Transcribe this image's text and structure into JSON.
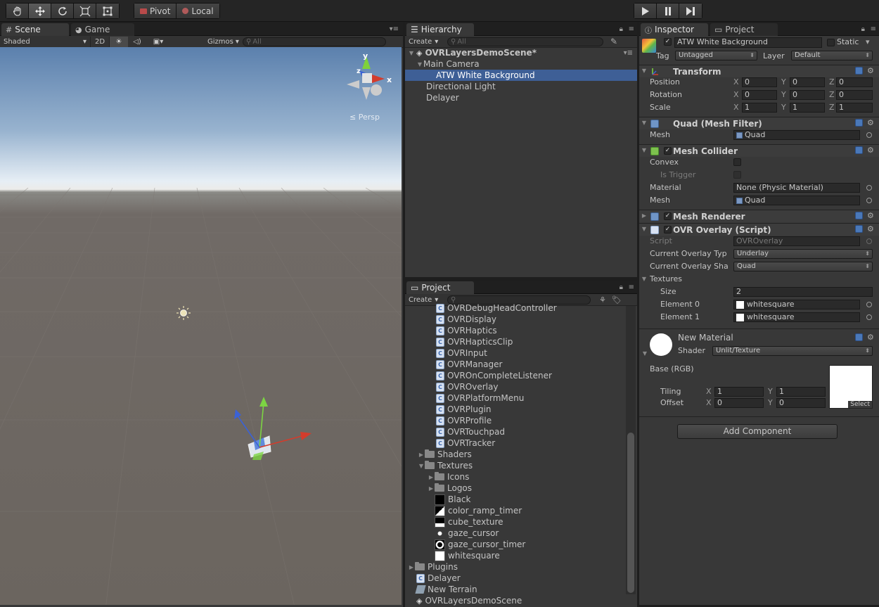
{
  "toolbar": {
    "pivot_label": "Pivot",
    "local_label": "Local"
  },
  "scene": {
    "tab_label": "Scene",
    "game_tab_label": "Game",
    "shading_mode": "Shaded",
    "mode_2d": "2D",
    "gizmos_label": "Gizmos",
    "search_placeholder": "All",
    "persp_label": "Persp",
    "axis_y": "y",
    "axis_x": "x",
    "axis_z": "z"
  },
  "hierarchy": {
    "tab_label": "Hierarchy",
    "create_label": "Create",
    "search_placeholder": "All",
    "scene_name": "OVRLayersDemoScene*",
    "items": [
      {
        "label": "Main Camera"
      },
      {
        "label": "ATW White Background"
      },
      {
        "label": "Directional Light"
      },
      {
        "label": "Delayer"
      }
    ]
  },
  "project": {
    "tab_label": "Project",
    "create_label": "Create",
    "items": [
      {
        "label": "OVRDebugHeadController"
      },
      {
        "label": "OVRDisplay"
      },
      {
        "label": "OVRHaptics"
      },
      {
        "label": "OVRHapticsClip"
      },
      {
        "label": "OVRInput"
      },
      {
        "label": "OVRManager"
      },
      {
        "label": "OVROnCompleteListener"
      },
      {
        "label": "OVROverlay"
      },
      {
        "label": "OVRPlatformMenu"
      },
      {
        "label": "OVRPlugin"
      },
      {
        "label": "OVRProfile"
      },
      {
        "label": "OVRTouchpad"
      },
      {
        "label": "OVRTracker"
      },
      {
        "label": "Shaders"
      },
      {
        "label": "Textures"
      },
      {
        "label": "Icons"
      },
      {
        "label": "Logos"
      },
      {
        "label": "Black"
      },
      {
        "label": "color_ramp_timer"
      },
      {
        "label": "cube_texture"
      },
      {
        "label": "gaze_cursor"
      },
      {
        "label": "gaze_cursor_timer"
      },
      {
        "label": "whitesquare"
      },
      {
        "label": "Plugins"
      },
      {
        "label": "Delayer"
      },
      {
        "label": "New Terrain"
      },
      {
        "label": "OVRLayersDemoScene"
      }
    ]
  },
  "inspector": {
    "tab_label": "Inspector",
    "project_tab_label": "Project",
    "object_name": "ATW White Background",
    "static_label": "Static",
    "tag_label": "Tag",
    "tag_value": "Untagged",
    "layer_label": "Layer",
    "layer_value": "Default",
    "transform": {
      "title": "Transform",
      "position_label": "Position",
      "rotation_label": "Rotation",
      "scale_label": "Scale",
      "position": {
        "x": "0",
        "y": "0",
        "z": "0"
      },
      "rotation": {
        "x": "0",
        "y": "0",
        "z": "0"
      },
      "scale": {
        "x": "1",
        "y": "1",
        "z": "1"
      }
    },
    "mesh_filter": {
      "title": "Quad (Mesh Filter)",
      "mesh_label": "Mesh",
      "mesh_value": "Quad"
    },
    "mesh_collider": {
      "title": "Mesh Collider",
      "convex_label": "Convex",
      "is_trigger_label": "Is Trigger",
      "material_label": "Material",
      "material_value": "None (Physic Material)",
      "mesh_label": "Mesh",
      "mesh_value": "Quad"
    },
    "mesh_renderer": {
      "title": "Mesh Renderer"
    },
    "ovr_overlay": {
      "title": "OVR Overlay (Script)",
      "script_label": "Script",
      "script_value": "OVROverlay",
      "overlay_type_label": "Current Overlay Typ",
      "overlay_type_value": "Underlay",
      "overlay_shape_label": "Current Overlay Sha",
      "overlay_shape_value": "Quad",
      "textures_label": "Textures",
      "size_label": "Size",
      "size_value": "2",
      "element0_label": "Element 0",
      "element0_value": "whitesquare",
      "element1_label": "Element 1",
      "element1_value": "whitesquare"
    },
    "material": {
      "name": "New Material",
      "shader_label": "Shader",
      "shader_value": "Unlit/Texture",
      "base_label": "Base (RGB)",
      "tiling_label": "Tiling",
      "offset_label": "Offset",
      "tiling": {
        "x": "1",
        "y": "1"
      },
      "offset": {
        "x": "0",
        "y": "0"
      },
      "select_label": "Select"
    },
    "add_component_label": "Add Component"
  },
  "colors": {
    "selection": "#3e5f96",
    "panel": "#383838",
    "background": "#1e1e1e"
  }
}
